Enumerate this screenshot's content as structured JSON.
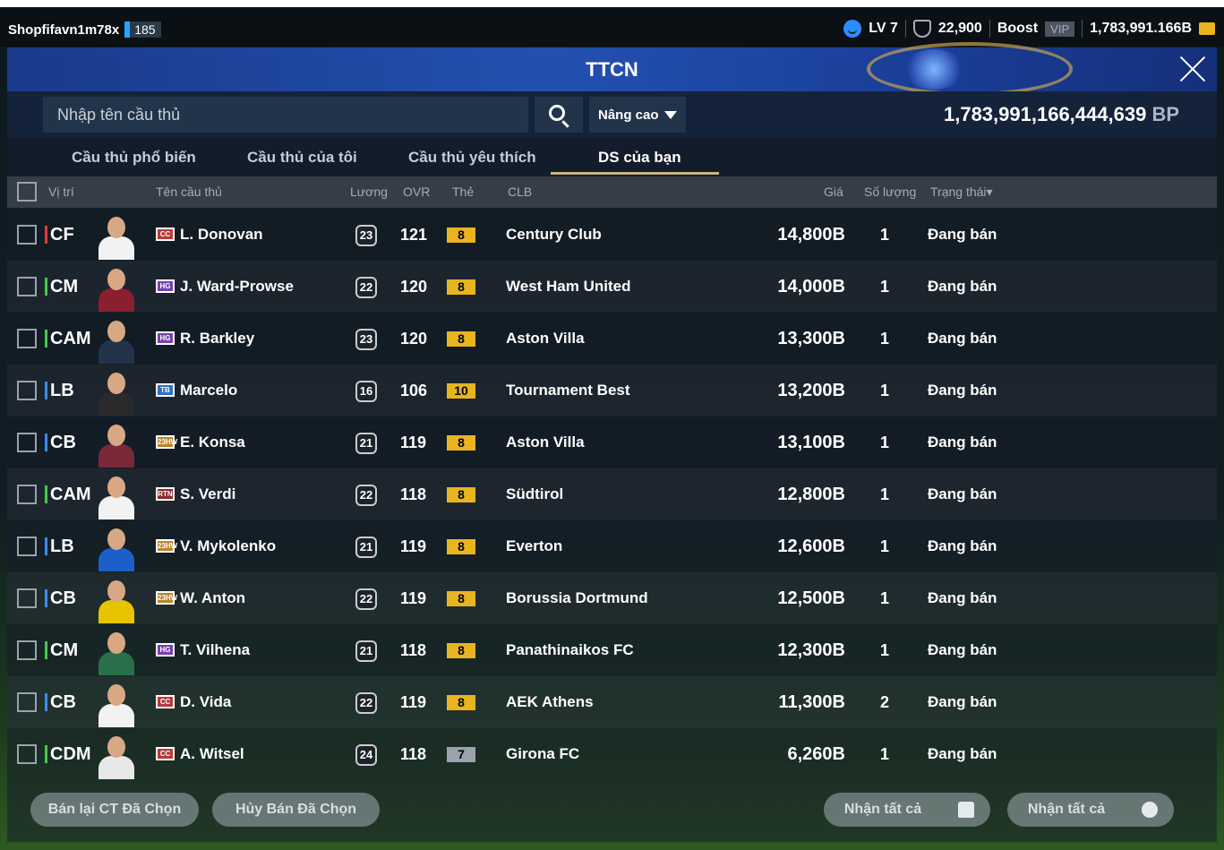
{
  "header": {
    "username": "Shopfifavn1m78x",
    "user_level": "185",
    "lv": "LV 7",
    "points": "22,900",
    "boost": "Boost",
    "vip": "VIP",
    "bp_short": "1,783,991.166B"
  },
  "window": {
    "title": "TTCN",
    "search_placeholder": "Nhập tên cầu thủ",
    "advanced_label": "Nâng cao",
    "bp_total": "1,783,991,166,444,639",
    "bp_unit": "BP"
  },
  "tabs": [
    "Cầu thủ phổ biến",
    "Cầu thủ của tôi",
    "Cầu thủ yêu thích",
    "DS của bạn"
  ],
  "columns": {
    "position": "Vị trí",
    "name": "Tên cầu thủ",
    "salary": "Lương",
    "ovr": "OVR",
    "card": "Thẻ",
    "club": "CLB",
    "price": "Giá",
    "quantity": "Số lượng",
    "status": "Trạng thái▾"
  },
  "rows": [
    {
      "pos": "CF",
      "pos_color": "#e53b3b",
      "season": "CC",
      "season_color": "#b83a3a",
      "name": "L. Donovan",
      "salary": "23",
      "ovr": "121",
      "card": "8",
      "club": "Century Club",
      "price": "14,800B",
      "qty": "1",
      "status": "Đang bán"
    },
    {
      "pos": "CM",
      "pos_color": "#46c94a",
      "season": "HG",
      "season_color": "#7a3fb0",
      "name": "J. Ward-Prowse",
      "salary": "22",
      "ovr": "120",
      "card": "8",
      "club": "West Ham United",
      "price": "14,000B",
      "qty": "1",
      "status": "Đang bán"
    },
    {
      "pos": "CAM",
      "pos_color": "#46c94a",
      "season": "HG",
      "season_color": "#7a3fb0",
      "name": "R. Barkley",
      "salary": "23",
      "ovr": "120",
      "card": "8",
      "club": "Aston Villa",
      "price": "13,300B",
      "qty": "1",
      "status": "Đang bán"
    },
    {
      "pos": "LB",
      "pos_color": "#3a8cf0",
      "season": "TB",
      "season_color": "#2f6fc2",
      "name": "Marcelo",
      "salary": "16",
      "ovr": "106",
      "card": "10",
      "club": "Tournament Best",
      "price": "13,200B",
      "qty": "1",
      "status": "Đang bán"
    },
    {
      "pos": "CB",
      "pos_color": "#3a8cf0",
      "season": "23HW",
      "season_color": "#b8862a",
      "name": "E. Konsa",
      "salary": "21",
      "ovr": "119",
      "card": "8",
      "club": "Aston Villa",
      "price": "13,100B",
      "qty": "1",
      "status": "Đang bán"
    },
    {
      "pos": "CAM",
      "pos_color": "#46c94a",
      "season": "RTN",
      "season_color": "#8a2a2a",
      "name": "S. Verdi",
      "salary": "22",
      "ovr": "118",
      "card": "8",
      "club": "Südtirol",
      "price": "12,800B",
      "qty": "1",
      "status": "Đang bán"
    },
    {
      "pos": "LB",
      "pos_color": "#3a8cf0",
      "season": "23HW",
      "season_color": "#b8862a",
      "name": "V. Mykolenko",
      "salary": "21",
      "ovr": "119",
      "card": "8",
      "club": "Everton",
      "price": "12,600B",
      "qty": "1",
      "status": "Đang bán"
    },
    {
      "pos": "CB",
      "pos_color": "#3a8cf0",
      "season": "23HW",
      "season_color": "#b8862a",
      "name": "W. Anton",
      "salary": "22",
      "ovr": "119",
      "card": "8",
      "club": "Borussia Dortmund",
      "price": "12,500B",
      "qty": "1",
      "status": "Đang bán"
    },
    {
      "pos": "CM",
      "pos_color": "#46c94a",
      "season": "HG",
      "season_color": "#7a3fb0",
      "name": "T. Vilhena",
      "salary": "21",
      "ovr": "118",
      "card": "8",
      "club": "Panathinaikos FC",
      "price": "12,300B",
      "qty": "1",
      "status": "Đang bán"
    },
    {
      "pos": "CB",
      "pos_color": "#3a8cf0",
      "season": "CC",
      "season_color": "#b83a3a",
      "name": "D. Vida",
      "salary": "22",
      "ovr": "119",
      "card": "8",
      "club": "AEK Athens",
      "price": "11,300B",
      "qty": "2",
      "status": "Đang bán"
    },
    {
      "pos": "CDM",
      "pos_color": "#46c94a",
      "season": "CC",
      "season_color": "#b83a3a",
      "name": "A. Witsel",
      "salary": "24",
      "ovr": "118",
      "card": "7",
      "club": "Girona FC",
      "price": "6,260B",
      "qty": "1",
      "status": "Đang bán"
    }
  ],
  "footer": {
    "resell_selected": "Bán lại CT Đã Chọn",
    "cancel_selected": "Hủy Bán Đã Chọn",
    "receive_all_1": "Nhận tất cả",
    "receive_all_2": "Nhận tất cả"
  }
}
